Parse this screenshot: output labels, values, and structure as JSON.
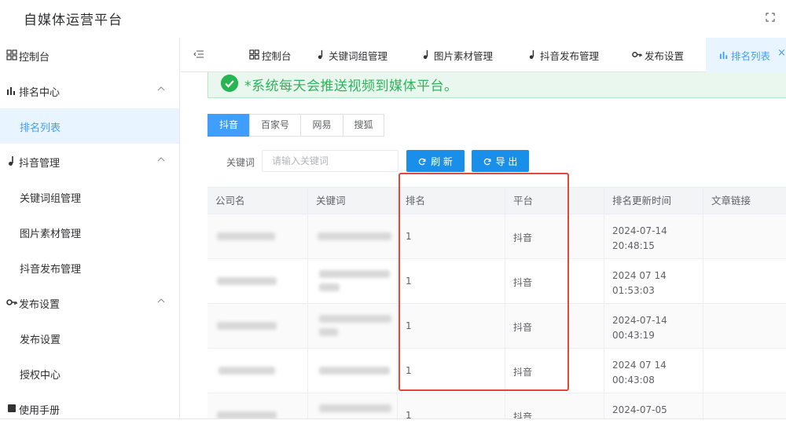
{
  "header": {
    "title": "自媒体运营平台",
    "fullscreen_icon": "fullscreen-icon"
  },
  "sidebar": {
    "items": [
      {
        "label": "控制台",
        "icon": "dashboard-icon",
        "type": "item"
      },
      {
        "label": "排名中心",
        "icon": "bar-chart-icon",
        "type": "group",
        "expanded": true
      },
      {
        "label": "排名列表",
        "type": "sub",
        "active": true
      },
      {
        "label": "抖音管理",
        "icon": "music-note-icon",
        "type": "group",
        "expanded": true
      },
      {
        "label": "关键词组管理",
        "type": "sub"
      },
      {
        "label": "图片素材管理",
        "type": "sub"
      },
      {
        "label": "抖音发布管理",
        "type": "sub"
      },
      {
        "label": "发布设置",
        "icon": "key-icon",
        "type": "group",
        "expanded": true
      },
      {
        "label": "发布设置",
        "type": "sub"
      },
      {
        "label": "授权中心",
        "type": "sub"
      },
      {
        "label": "使用手册",
        "icon": "book-icon",
        "type": "item"
      }
    ]
  },
  "tabs": [
    {
      "label": "控制台",
      "icon": "dashboard-icon"
    },
    {
      "label": "关键词组管理",
      "icon": "music-note-icon"
    },
    {
      "label": "图片素材管理",
      "icon": "music-note-icon"
    },
    {
      "label": "抖音发布管理",
      "icon": "music-note-icon"
    },
    {
      "label": "发布设置",
      "icon": "key-icon"
    },
    {
      "label": "排名列表",
      "icon": "bar-chart-icon",
      "active": true,
      "close": "×"
    }
  ],
  "alert": {
    "text": "*系统每天会推送视频到媒体平台。",
    "color": "#2fb45c"
  },
  "platforms": [
    {
      "label": "抖音",
      "active": true
    },
    {
      "label": "百家号"
    },
    {
      "label": "网易"
    },
    {
      "label": "搜狐"
    }
  ],
  "search": {
    "label": "关键词",
    "placeholder": "请输入关键词",
    "value": ""
  },
  "buttons": {
    "refresh": "刷 新",
    "export": "导 出"
  },
  "table": {
    "columns": [
      "公司名",
      "关键词",
      "排名",
      "平台",
      "排名更新时间",
      "文章链接"
    ],
    "rows": [
      {
        "company": "",
        "keyword": "",
        "rank": "1",
        "platform": "抖音",
        "date": "2024-07-14",
        "time": "20:48:15",
        "link": ""
      },
      {
        "company": "",
        "keyword": "",
        "rank": "1",
        "platform": "抖音",
        "date": "2024 07 14",
        "time": "01:53:03",
        "link": ""
      },
      {
        "company": "",
        "keyword": "",
        "rank": "1",
        "platform": "抖音",
        "date": "2024-07-14",
        "time": "00:43:19",
        "link": ""
      },
      {
        "company": "",
        "keyword": "",
        "rank": "1",
        "platform": "抖音",
        "date": "2024 07 14",
        "time": "00:43:08",
        "link": ""
      },
      {
        "company": "",
        "keyword": "",
        "rank": "1",
        "platform": "抖音",
        "date": "2024-07-05",
        "time": "",
        "link": ""
      }
    ]
  },
  "colors": {
    "primary": "#409eff",
    "button": "#1a8fea",
    "success": "#26b550",
    "highlight": "#e6463c"
  }
}
